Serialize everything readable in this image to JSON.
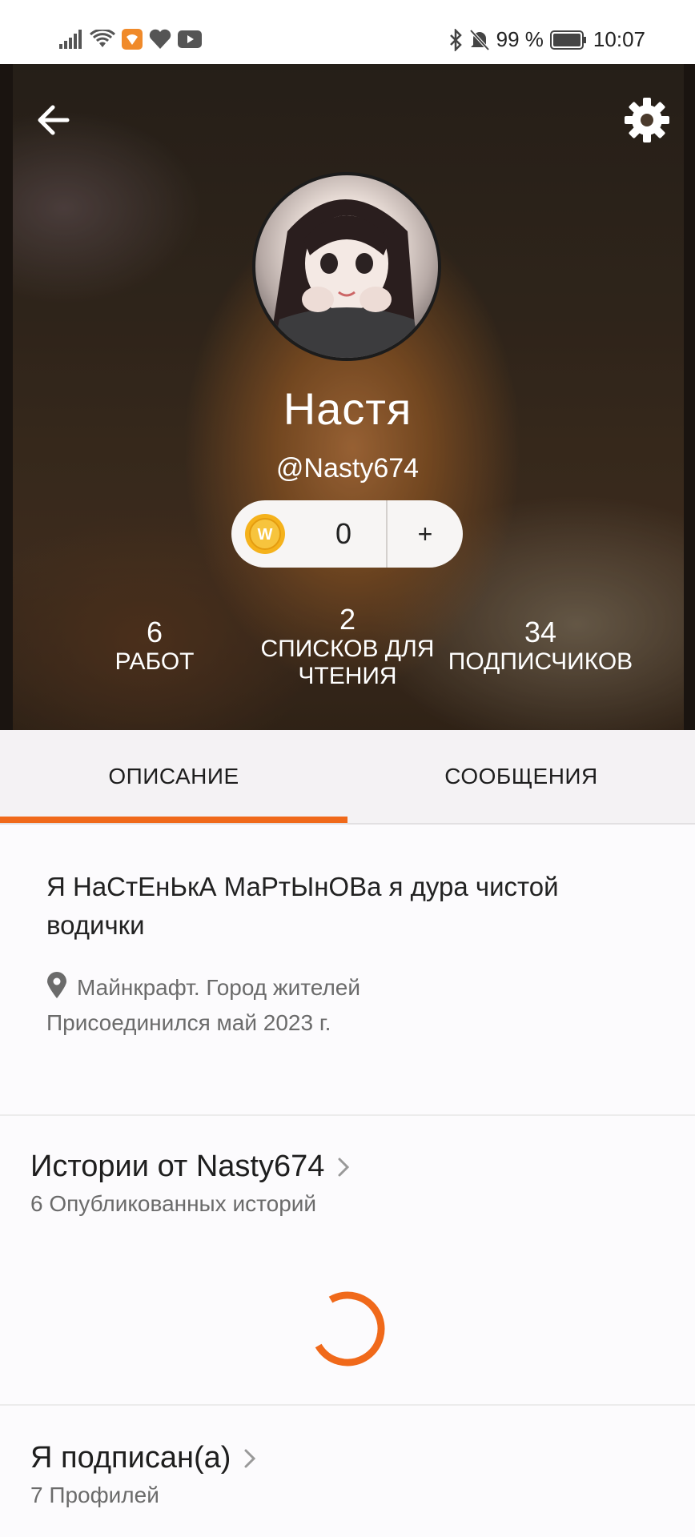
{
  "status_bar": {
    "battery_percent": "99 %",
    "time": "10:07"
  },
  "profile": {
    "display_name": "Настя",
    "username": "@Nasty674",
    "coins": "0",
    "coins_add_label": "+",
    "stats": [
      {
        "value": "6",
        "label": "РАБОТ"
      },
      {
        "value": "2",
        "label": "СПИСКОВ ДЛЯ ЧТЕНИЯ"
      },
      {
        "value": "34",
        "label": "ПОДПИСЧИКОВ"
      }
    ]
  },
  "tabs": [
    {
      "label": "ОПИСАНИЕ",
      "active": true
    },
    {
      "label": "СООБЩЕНИЯ",
      "active": false
    }
  ],
  "about": {
    "text": "Я НаСтЕнЬкА МаРтЫнОВа я дура чистой водички",
    "location": "Майнкрафт. Город жителей",
    "joined": "Присоединился май 2023 г."
  },
  "sections": {
    "stories": {
      "title": "Истории от Nasty674",
      "subtitle": "6 Опубликованных историй"
    },
    "following": {
      "title": "Я подписан(а)",
      "subtitle": "7 Профилей"
    }
  },
  "colors": {
    "accent": "#f0691a",
    "coin": "#f5b21b"
  }
}
